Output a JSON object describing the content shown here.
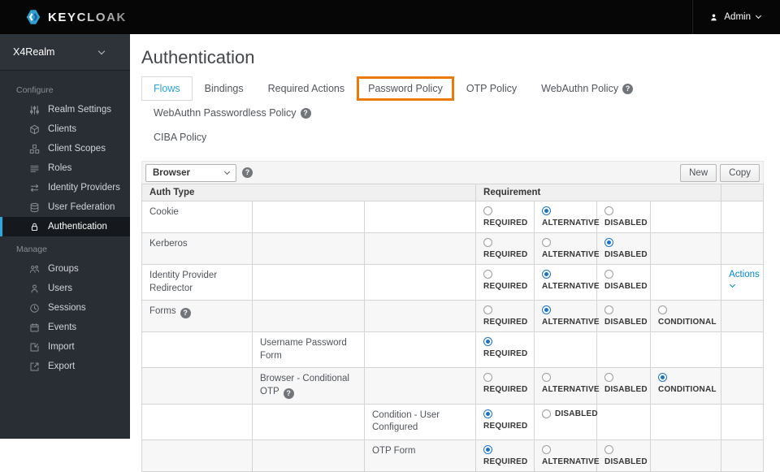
{
  "colors": {
    "accent_blue": "#0088ce",
    "active_tab_blue": "#2aa3d8",
    "highlight_orange": "#ec7a08",
    "radio_checked_blue": "#1a73c9",
    "sidebar_bg": "#292e34",
    "sidebar_active_bg": "#15181c",
    "sidebar_active_border": "#2aa9e0",
    "topbar_bg": "#060606"
  },
  "topbar": {
    "brand": "KEYCLOAK",
    "brand_icon": "keycloak-logo-icon",
    "user_label": "Admin",
    "user_icon": "user-icon",
    "chevron_icon": "chevron-down-icon"
  },
  "sidebar": {
    "realm": "X4Realm",
    "realm_chevron_icon": "chevron-down-icon",
    "sections": [
      {
        "label": "Configure",
        "items": [
          {
            "label": "Realm Settings",
            "icon": "sliders-icon"
          },
          {
            "label": "Clients",
            "icon": "cube-icon"
          },
          {
            "label": "Client Scopes",
            "icon": "cubes-icon"
          },
          {
            "label": "Roles",
            "icon": "list-icon"
          },
          {
            "label": "Identity Providers",
            "icon": "exchange-arrows-icon"
          },
          {
            "label": "User Federation",
            "icon": "database-icon"
          },
          {
            "label": "Authentication",
            "icon": "lock-icon",
            "active": true
          }
        ]
      },
      {
        "label": "Manage",
        "items": [
          {
            "label": "Groups",
            "icon": "users-icon"
          },
          {
            "label": "Users",
            "icon": "user-icon"
          },
          {
            "label": "Sessions",
            "icon": "clock-icon"
          },
          {
            "label": "Events",
            "icon": "calendar-icon"
          },
          {
            "label": "Import",
            "icon": "import-icon"
          },
          {
            "label": "Export",
            "icon": "export-icon"
          }
        ]
      }
    ]
  },
  "main": {
    "title": "Authentication",
    "tabs": [
      {
        "label": "Flows",
        "active": true
      },
      {
        "label": "Bindings"
      },
      {
        "label": "Required Actions"
      },
      {
        "label": "Password Policy",
        "highlighted": true
      },
      {
        "label": "OTP Policy"
      },
      {
        "label": "WebAuthn Policy",
        "help": true
      },
      {
        "label": "WebAuthn Passwordless Policy",
        "help": true
      },
      {
        "label": "CIBA Policy"
      }
    ],
    "toolbar": {
      "flow_selected": "Browser",
      "help_icon": "help-icon",
      "buttons": [
        "New",
        "Copy"
      ]
    },
    "table": {
      "auth_type_header": "Auth Type",
      "requirement_header": "Requirement",
      "rows": [
        {
          "label": "Cookie",
          "level": 1,
          "cells": [
            {
              "label": "REQUIRED"
            },
            {
              "label": "ALTERNATIVE",
              "checked": true
            },
            {
              "label": "DISABLED"
            },
            null
          ]
        },
        {
          "label": "Kerberos",
          "level": 1,
          "cells": [
            {
              "label": "REQUIRED"
            },
            {
              "label": "ALTERNATIVE"
            },
            {
              "label": "DISABLED",
              "checked": true
            },
            null
          ]
        },
        {
          "label": "Identity Provider Redirector",
          "level": 1,
          "actions": "Actions",
          "cells": [
            {
              "label": "REQUIRED"
            },
            {
              "label": "ALTERNATIVE",
              "checked": true
            },
            {
              "label": "DISABLED"
            },
            null
          ]
        },
        {
          "label": "Forms",
          "level": 1,
          "help": true,
          "cells": [
            {
              "label": "REQUIRED"
            },
            {
              "label": "ALTERNATIVE",
              "checked": true
            },
            {
              "label": "DISABLED"
            },
            {
              "label": "CONDITIONAL"
            }
          ]
        },
        {
          "label": "Username Password Form",
          "level": 2,
          "cells": [
            {
              "label": "REQUIRED",
              "checked": true
            },
            null,
            null,
            null
          ]
        },
        {
          "label": "Browser - Conditional OTP",
          "level": 2,
          "help": true,
          "cells": [
            {
              "label": "REQUIRED"
            },
            {
              "label": "ALTERNATIVE"
            },
            {
              "label": "DISABLED"
            },
            {
              "label": "CONDITIONAL",
              "checked": true
            }
          ]
        },
        {
          "label": "Condition - User Configured",
          "level": 3,
          "cells": [
            {
              "label": "REQUIRED",
              "checked": true
            },
            {
              "label": "DISABLED",
              "inline": true
            },
            null,
            null
          ]
        },
        {
          "label": "OTP Form",
          "level": 3,
          "cells": [
            {
              "label": "REQUIRED",
              "checked": true
            },
            {
              "label": "ALTERNATIVE"
            },
            {
              "label": "DISABLED"
            },
            null
          ]
        }
      ]
    }
  }
}
